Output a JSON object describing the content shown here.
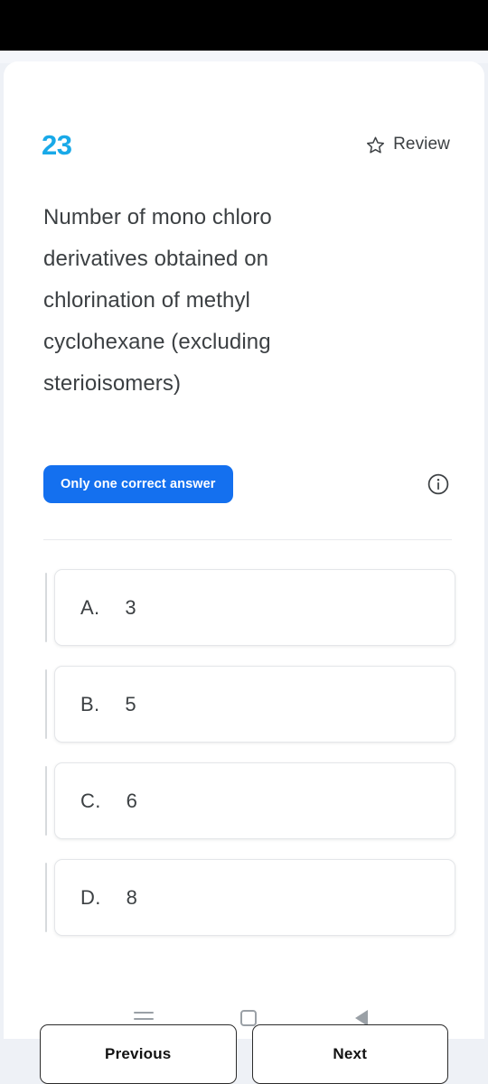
{
  "colors": {
    "question_number": "#19a9e8",
    "badge_background": "#1470ef",
    "badge_text": "#ffffff",
    "text_primary": "#3c4043",
    "page_background": "#eef1f6",
    "card_background": "#ffffff",
    "status_bar": "#000000"
  },
  "header": {
    "question_number": "23",
    "review_label": "Review",
    "star_icon": "star-outline-icon"
  },
  "question": {
    "text": "Number of mono chloro derivatives obtained on chlorination of methyl cyclohexane (excluding sterioisomers)"
  },
  "meta": {
    "badge_label": "Only one correct answer",
    "info_icon": "info-circle-icon"
  },
  "options": [
    {
      "letter": "A.",
      "value": "3"
    },
    {
      "letter": "B.",
      "value": "5"
    },
    {
      "letter": "C.",
      "value": "6"
    },
    {
      "letter": "D.",
      "value": "8"
    }
  ],
  "footer": {
    "previous_label": "Previous",
    "next_label": "Next"
  },
  "system_nav": {
    "recents_icon": "recents-icon",
    "home_icon": "home-square-icon",
    "back_icon": "back-triangle-icon"
  }
}
